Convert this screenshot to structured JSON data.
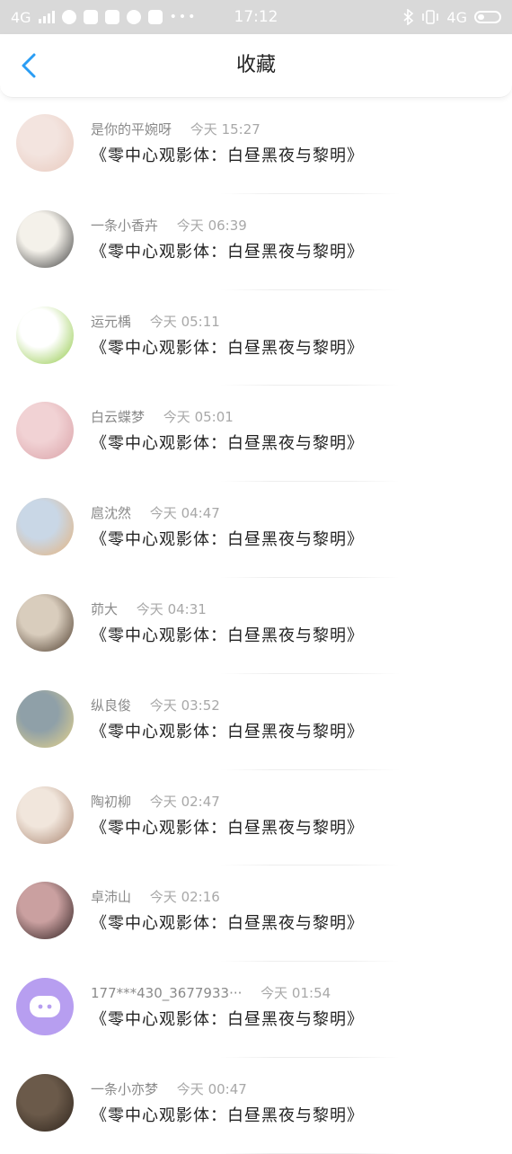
{
  "status_bar": {
    "network": "4G",
    "time": "17:12",
    "network_right": "4G",
    "more": "•••"
  },
  "header": {
    "title": "收藏"
  },
  "items": [
    {
      "name": "是你的平婉呀",
      "time": "今天 15:27",
      "content": "《零中心观影体：白昼黑夜与黎明》",
      "avatar_colors": [
        "#f3e4df",
        "#e8c9bd"
      ]
    },
    {
      "name": "一条小香卉",
      "time": "今天 06:39",
      "content": "《零中心观影体：白昼黑夜与黎明》",
      "avatar_colors": [
        "#f4f1ea",
        "#3a3a3a"
      ]
    },
    {
      "name": "运元楀",
      "time": "今天 05:11",
      "content": "《零中心观影体：白昼黑夜与黎明》",
      "avatar_colors": [
        "#ffffff",
        "#8dc63f"
      ]
    },
    {
      "name": "白云蝶梦",
      "time": "今天 05:01",
      "content": "《零中心观影体：白昼黑夜与黎明》",
      "avatar_colors": [
        "#f1d2d4",
        "#d9a0a6"
      ]
    },
    {
      "name": "扈沈然",
      "time": "今天 04:47",
      "content": "《零中心观影体：白昼黑夜与黎明》",
      "avatar_colors": [
        "#c9d7e6",
        "#e6b27a"
      ]
    },
    {
      "name": "茆大",
      "time": "今天 04:31",
      "content": "《零中心观影体：白昼黑夜与黎明》",
      "avatar_colors": [
        "#d9cdbd",
        "#4b3a2b"
      ]
    },
    {
      "name": "纵良俊",
      "time": "今天 03:52",
      "content": "《零中心观影体：白昼黑夜与黎明》",
      "avatar_colors": [
        "#8fa0a8",
        "#e8d48a"
      ]
    },
    {
      "name": "陶初柳",
      "time": "今天 02:47",
      "content": "《零中心观影体：白昼黑夜与黎明》",
      "avatar_colors": [
        "#f1e6dc",
        "#a8836e"
      ]
    },
    {
      "name": "卓沛山",
      "time": "今天 02:16",
      "content": "《零中心观影体：白昼黑夜与黎明》",
      "avatar_colors": [
        "#caa0a0",
        "#2a1c1c"
      ]
    },
    {
      "name": "177***430_3677933···",
      "time": "今天 01:54",
      "content": "《零中心观影体：白昼黑夜与黎明》",
      "avatar_colors": [
        "#d6c8f4",
        "#b79ef0"
      ]
    },
    {
      "name": "一条小亦梦",
      "time": "今天 00:47",
      "content": "《零中心观影体：白昼黑夜与黎明》",
      "avatar_colors": [
        "#6b5a4a",
        "#2e241c"
      ]
    }
  ]
}
